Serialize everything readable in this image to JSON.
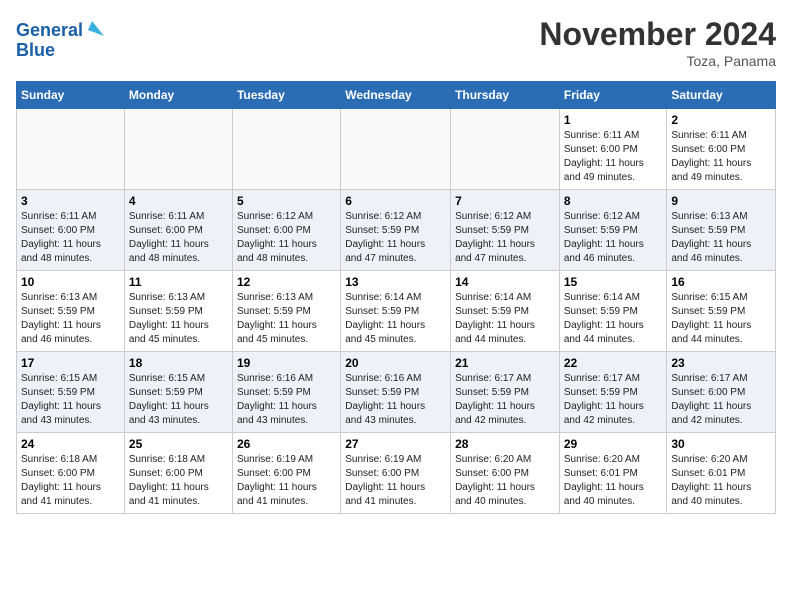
{
  "logo": {
    "line1": "General",
    "line2": "Blue"
  },
  "title": "November 2024",
  "location": "Toza, Panama",
  "days_of_week": [
    "Sunday",
    "Monday",
    "Tuesday",
    "Wednesday",
    "Thursday",
    "Friday",
    "Saturday"
  ],
  "weeks": [
    [
      {
        "day": "",
        "info": ""
      },
      {
        "day": "",
        "info": ""
      },
      {
        "day": "",
        "info": ""
      },
      {
        "day": "",
        "info": ""
      },
      {
        "day": "",
        "info": ""
      },
      {
        "day": "1",
        "info": "Sunrise: 6:11 AM\nSunset: 6:00 PM\nDaylight: 11 hours\nand 49 minutes."
      },
      {
        "day": "2",
        "info": "Sunrise: 6:11 AM\nSunset: 6:00 PM\nDaylight: 11 hours\nand 49 minutes."
      }
    ],
    [
      {
        "day": "3",
        "info": "Sunrise: 6:11 AM\nSunset: 6:00 PM\nDaylight: 11 hours\nand 48 minutes."
      },
      {
        "day": "4",
        "info": "Sunrise: 6:11 AM\nSunset: 6:00 PM\nDaylight: 11 hours\nand 48 minutes."
      },
      {
        "day": "5",
        "info": "Sunrise: 6:12 AM\nSunset: 6:00 PM\nDaylight: 11 hours\nand 48 minutes."
      },
      {
        "day": "6",
        "info": "Sunrise: 6:12 AM\nSunset: 5:59 PM\nDaylight: 11 hours\nand 47 minutes."
      },
      {
        "day": "7",
        "info": "Sunrise: 6:12 AM\nSunset: 5:59 PM\nDaylight: 11 hours\nand 47 minutes."
      },
      {
        "day": "8",
        "info": "Sunrise: 6:12 AM\nSunset: 5:59 PM\nDaylight: 11 hours\nand 46 minutes."
      },
      {
        "day": "9",
        "info": "Sunrise: 6:13 AM\nSunset: 5:59 PM\nDaylight: 11 hours\nand 46 minutes."
      }
    ],
    [
      {
        "day": "10",
        "info": "Sunrise: 6:13 AM\nSunset: 5:59 PM\nDaylight: 11 hours\nand 46 minutes."
      },
      {
        "day": "11",
        "info": "Sunrise: 6:13 AM\nSunset: 5:59 PM\nDaylight: 11 hours\nand 45 minutes."
      },
      {
        "day": "12",
        "info": "Sunrise: 6:13 AM\nSunset: 5:59 PM\nDaylight: 11 hours\nand 45 minutes."
      },
      {
        "day": "13",
        "info": "Sunrise: 6:14 AM\nSunset: 5:59 PM\nDaylight: 11 hours\nand 45 minutes."
      },
      {
        "day": "14",
        "info": "Sunrise: 6:14 AM\nSunset: 5:59 PM\nDaylight: 11 hours\nand 44 minutes."
      },
      {
        "day": "15",
        "info": "Sunrise: 6:14 AM\nSunset: 5:59 PM\nDaylight: 11 hours\nand 44 minutes."
      },
      {
        "day": "16",
        "info": "Sunrise: 6:15 AM\nSunset: 5:59 PM\nDaylight: 11 hours\nand 44 minutes."
      }
    ],
    [
      {
        "day": "17",
        "info": "Sunrise: 6:15 AM\nSunset: 5:59 PM\nDaylight: 11 hours\nand 43 minutes."
      },
      {
        "day": "18",
        "info": "Sunrise: 6:15 AM\nSunset: 5:59 PM\nDaylight: 11 hours\nand 43 minutes."
      },
      {
        "day": "19",
        "info": "Sunrise: 6:16 AM\nSunset: 5:59 PM\nDaylight: 11 hours\nand 43 minutes."
      },
      {
        "day": "20",
        "info": "Sunrise: 6:16 AM\nSunset: 5:59 PM\nDaylight: 11 hours\nand 43 minutes."
      },
      {
        "day": "21",
        "info": "Sunrise: 6:17 AM\nSunset: 5:59 PM\nDaylight: 11 hours\nand 42 minutes."
      },
      {
        "day": "22",
        "info": "Sunrise: 6:17 AM\nSunset: 5:59 PM\nDaylight: 11 hours\nand 42 minutes."
      },
      {
        "day": "23",
        "info": "Sunrise: 6:17 AM\nSunset: 6:00 PM\nDaylight: 11 hours\nand 42 minutes."
      }
    ],
    [
      {
        "day": "24",
        "info": "Sunrise: 6:18 AM\nSunset: 6:00 PM\nDaylight: 11 hours\nand 41 minutes."
      },
      {
        "day": "25",
        "info": "Sunrise: 6:18 AM\nSunset: 6:00 PM\nDaylight: 11 hours\nand 41 minutes."
      },
      {
        "day": "26",
        "info": "Sunrise: 6:19 AM\nSunset: 6:00 PM\nDaylight: 11 hours\nand 41 minutes."
      },
      {
        "day": "27",
        "info": "Sunrise: 6:19 AM\nSunset: 6:00 PM\nDaylight: 11 hours\nand 41 minutes."
      },
      {
        "day": "28",
        "info": "Sunrise: 6:20 AM\nSunset: 6:00 PM\nDaylight: 11 hours\nand 40 minutes."
      },
      {
        "day": "29",
        "info": "Sunrise: 6:20 AM\nSunset: 6:01 PM\nDaylight: 11 hours\nand 40 minutes."
      },
      {
        "day": "30",
        "info": "Sunrise: 6:20 AM\nSunset: 6:01 PM\nDaylight: 11 hours\nand 40 minutes."
      }
    ]
  ]
}
